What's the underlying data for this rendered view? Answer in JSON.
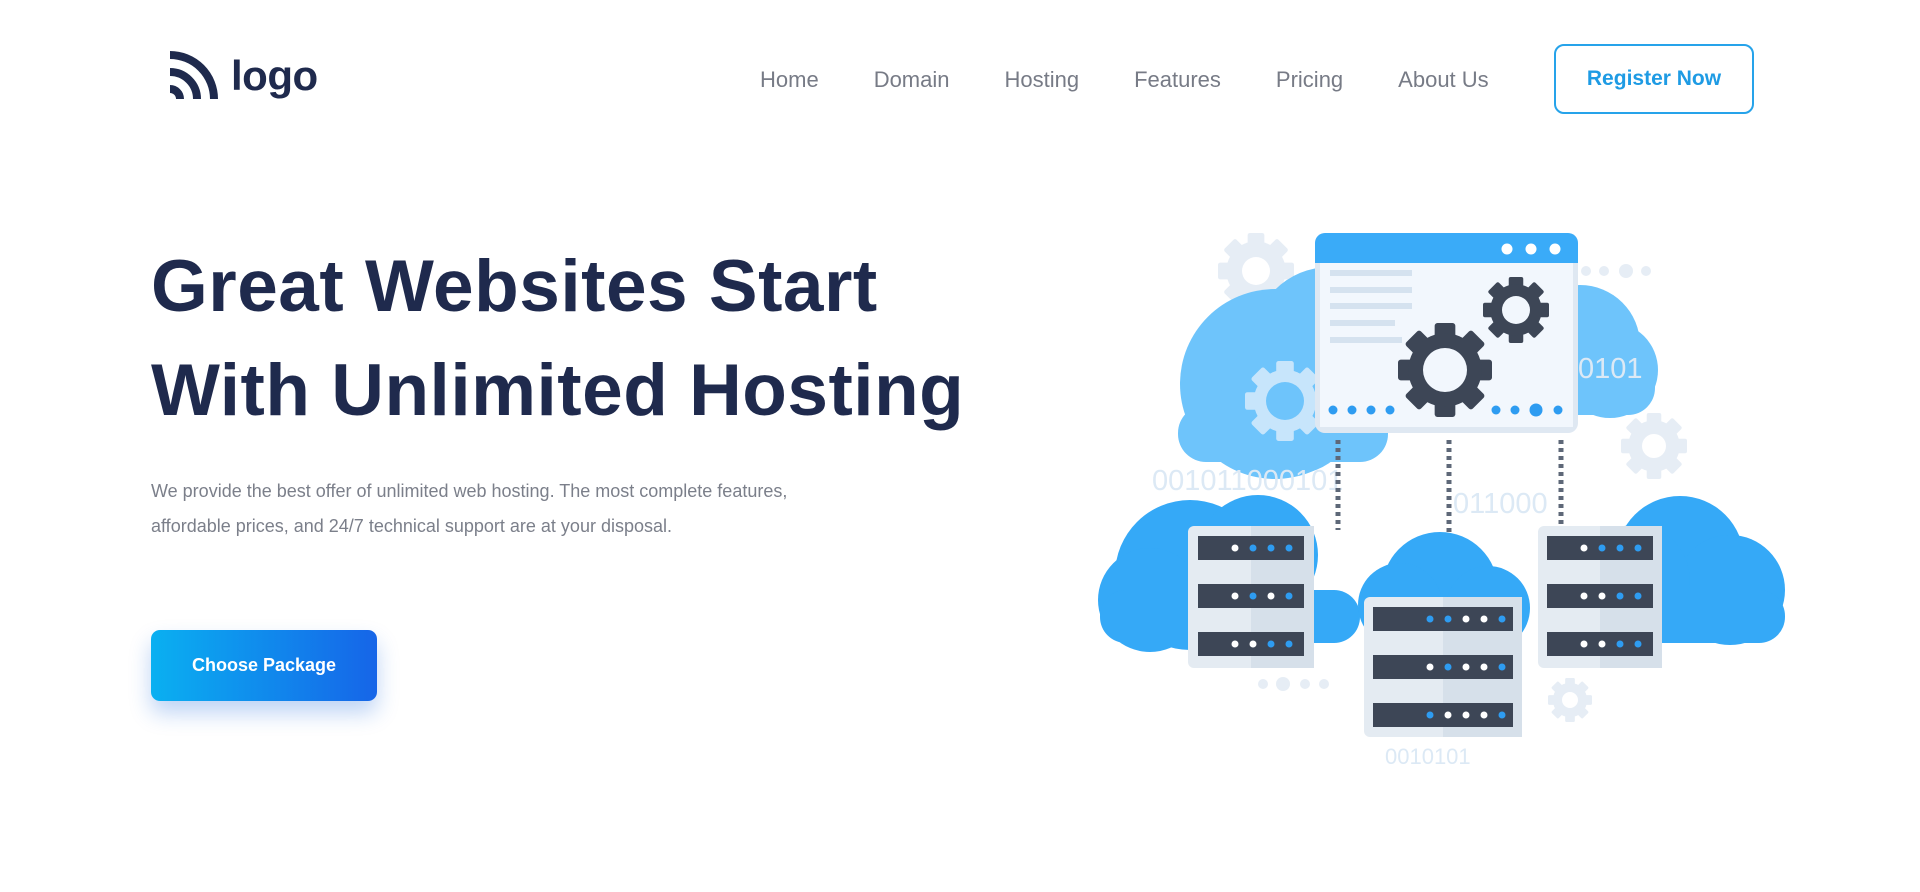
{
  "logo": {
    "text": "logo",
    "icon": "rss-arcs-icon"
  },
  "nav": {
    "items": [
      "Home",
      "Domain",
      "Hosting",
      "Features",
      "Pricing",
      "About Us"
    ],
    "register_label": "Register Now"
  },
  "hero": {
    "title_line1": "Great Websites Start",
    "title_line2": "With Unlimited Hosting",
    "description": "We provide the best offer of unlimited web hosting. The most complete features, affordable prices, and 24/7 technical support are at your disposal.",
    "cta_label": "Choose Package"
  },
  "illustration": {
    "binary_texts": [
      "001011000101",
      "011000",
      "0101",
      "0010101"
    ],
    "icons": [
      "cloud-icon",
      "server-rack-icon",
      "browser-window-icon",
      "gear-icon"
    ]
  },
  "colors": {
    "navy": "#1f2a4d",
    "accent_blue": "#26a3ea",
    "gradient_start": "#0ab0f1",
    "gradient_end": "#1665e8",
    "nav_text": "#777b86"
  }
}
